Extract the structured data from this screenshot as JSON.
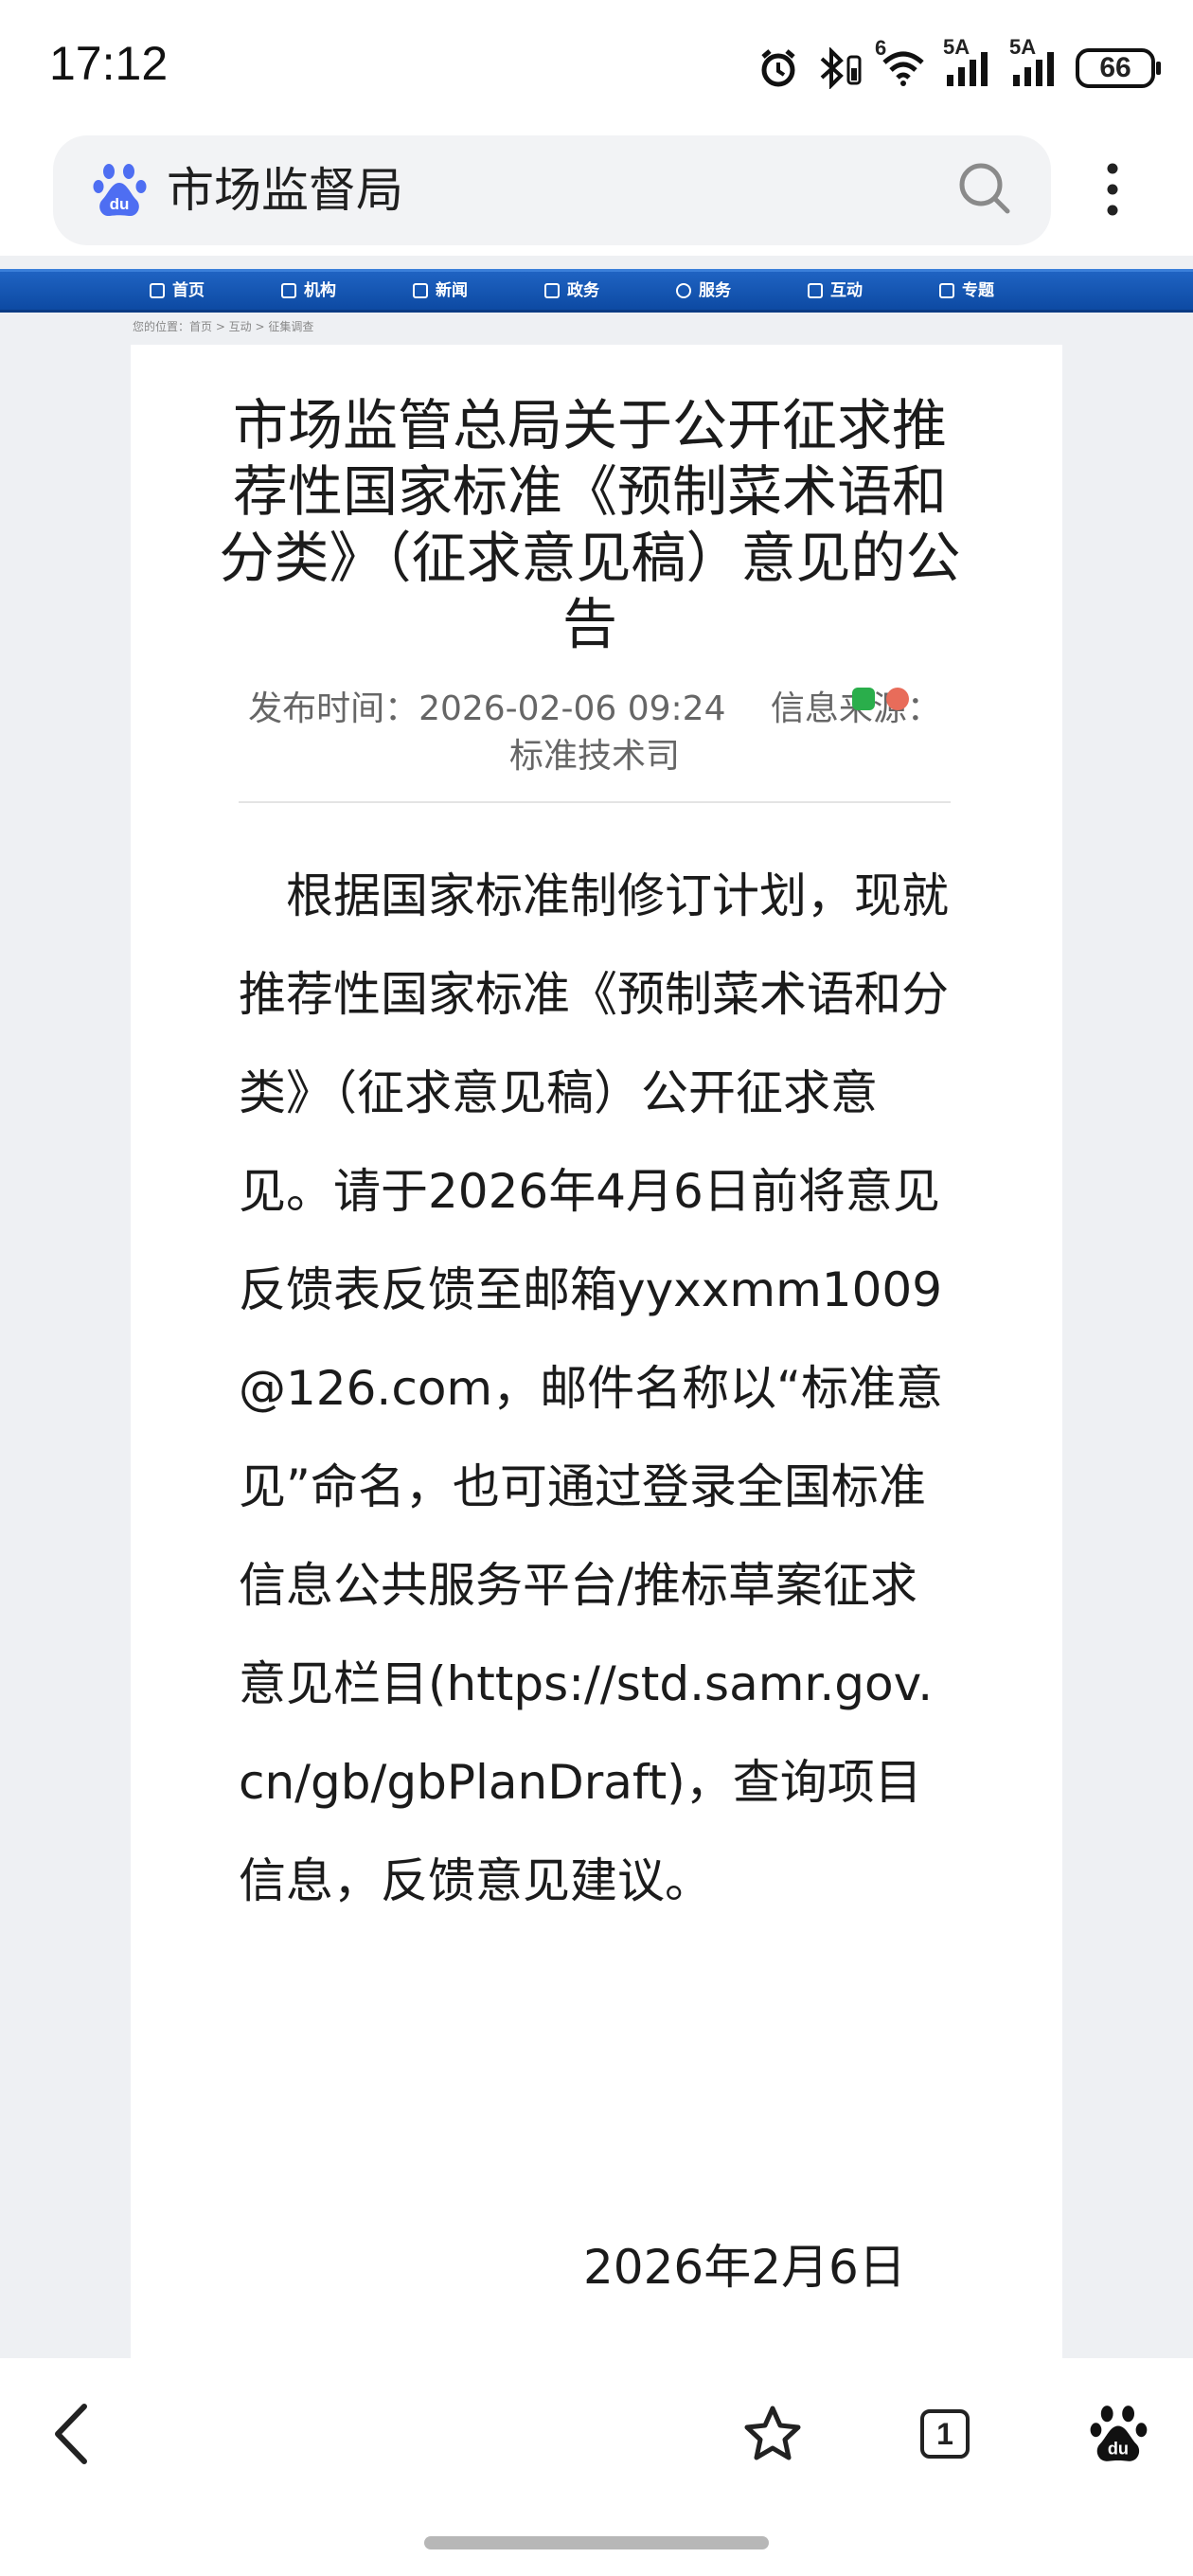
{
  "status_bar": {
    "time": "17:12",
    "network_labels": [
      "6",
      "5A",
      "5A"
    ],
    "battery": "66",
    "icons": [
      "alarm-icon",
      "bluetooth-icon",
      "wifi-icon",
      "signal-icon",
      "signal-icon",
      "battery-icon"
    ]
  },
  "search_bar": {
    "query": "市场监督局",
    "logo_icon": "baidu-paw-icon",
    "search_icon": "search-icon",
    "menu_icon": "more-vertical-icon",
    "logo_color": "#4e6ef2"
  },
  "site_nav": {
    "items": [
      {
        "label": "首页",
        "icon": "home-icon"
      },
      {
        "label": "机构",
        "icon": "org-icon"
      },
      {
        "label": "新闻",
        "icon": "news-icon"
      },
      {
        "label": "政务",
        "icon": "gov-icon"
      },
      {
        "label": "服务",
        "icon": "heart-icon"
      },
      {
        "label": "互动",
        "icon": "exchange-icon"
      },
      {
        "label": "专题",
        "icon": "list-icon"
      }
    ],
    "background_color": "#1556b3"
  },
  "breadcrumb": "您的位置：首页 > 互动 > 征集调查",
  "article": {
    "title": "市场监管总局关于公开征求推荐性国家标准《预制菜术语和分类》（征求意见稿）意见的公告",
    "meta": "发布时间：2026-02-06 09:24　 信息来源：标准技术司",
    "body": "根据国家标准制修订计划，现就推荐性国家标准《预制菜术语和分类》（征求意见稿）公开征求意见。请于2026年4月6日前将意见反馈表反馈至邮箱yyxxmm1009@126.com，邮件名称以“标准意见”命名，也可通过登录全国标准信息公共服务平台/推标草案征求意见栏目(https://std.samr.gov.cn/gb/gbPlanDraft)，查询项目信息，反馈意见建议。",
    "date": "2026年2月6日"
  },
  "bottom_bar": {
    "tab_count": "1",
    "icons": [
      "back-icon",
      "star-icon",
      "tabs-icon",
      "baidu-paw-icon"
    ]
  }
}
